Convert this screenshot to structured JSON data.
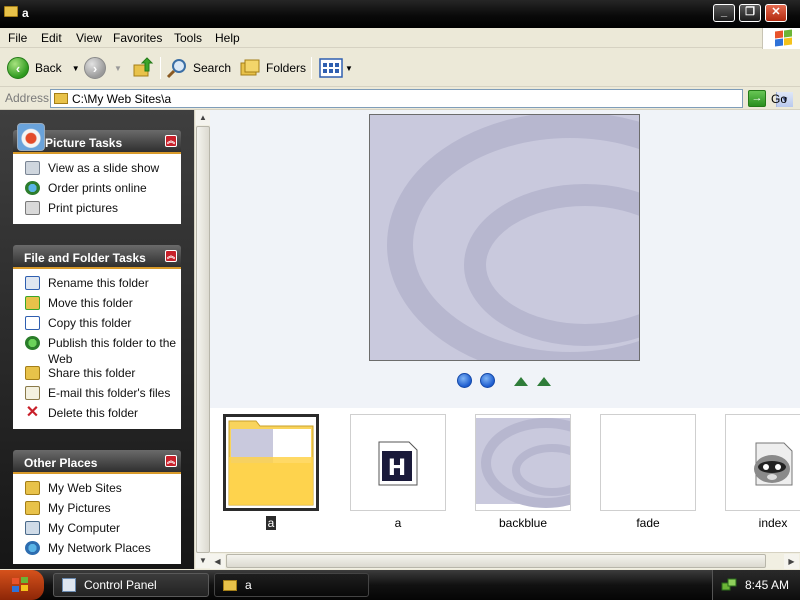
{
  "window": {
    "title": "a"
  },
  "menu": [
    "File",
    "Edit",
    "View",
    "Favorites",
    "Tools",
    "Help"
  ],
  "toolbar": {
    "back_label": "Back",
    "search_label": "Search",
    "folders_label": "Folders"
  },
  "address": {
    "label": "Address",
    "value": "C:\\My Web Sites\\a",
    "go_label": "Go"
  },
  "panels": {
    "picture_tasks": {
      "title": "Picture Tasks",
      "items": [
        "View as a slide show",
        "Order prints online",
        "Print pictures"
      ]
    },
    "file_folder_tasks": {
      "title": "File and Folder Tasks",
      "items": [
        "Rename this folder",
        "Move this folder",
        "Copy this folder",
        "Publish this folder to the Web",
        "Share this folder",
        "E-mail this folder's files",
        "Delete this folder"
      ]
    },
    "other_places": {
      "title": "Other Places",
      "items": [
        "My Web Sites",
        "My Pictures",
        "My Computer",
        "My Network Places"
      ]
    }
  },
  "files": [
    {
      "name": "a",
      "kind": "folder",
      "selected": true
    },
    {
      "name": "a",
      "kind": "html-file"
    },
    {
      "name": "backblue",
      "kind": "image"
    },
    {
      "name": "fade",
      "kind": "image"
    },
    {
      "name": "index",
      "kind": "raccoon-icon"
    }
  ],
  "taskbar": {
    "tasks": [
      "Control Panel",
      "a"
    ],
    "clock": "8:45 AM"
  },
  "colors": {
    "title_bar": "#111111",
    "panel_header": "#3f3f3f",
    "accent_orange": "#d89a2a",
    "selection": "#2b2b2b"
  }
}
